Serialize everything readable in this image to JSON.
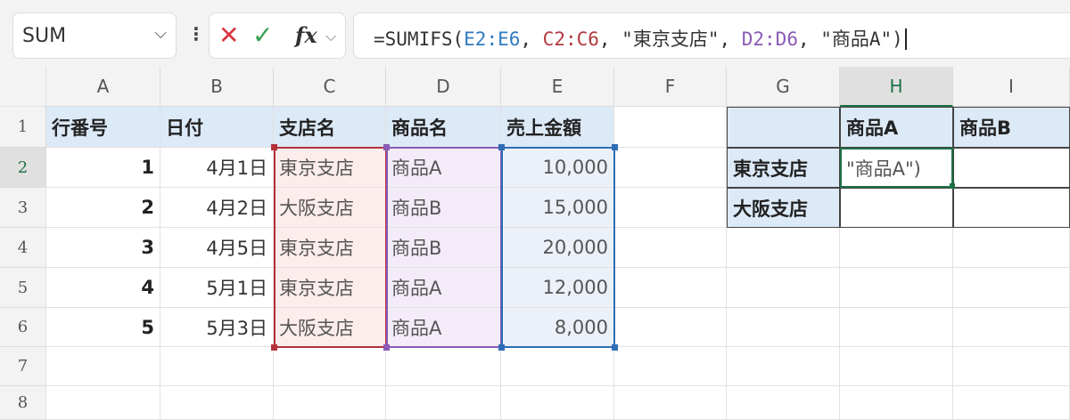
{
  "name_box": {
    "value": "SUM",
    "chevron_icon": "chevron-down"
  },
  "formula_bar": {
    "cancel_icon": "x-icon",
    "enter_icon": "check-icon",
    "fx_label": "fx",
    "formula_parts": [
      "=SUMIFS(",
      "E2:E6",
      ", ",
      "C2:C6",
      ", \"東京支店\", ",
      "D2:D6",
      ", \"商品A\")"
    ]
  },
  "colors": {
    "range_e": "#2f6db5",
    "range_c": "#b5323b",
    "range_d": "#8a5bb5",
    "active": "#1e7145"
  },
  "columns": [
    "A",
    "B",
    "C",
    "D",
    "E",
    "F",
    "G",
    "H",
    "I"
  ],
  "rows": [
    "1",
    "2",
    "3",
    "4",
    "5",
    "6",
    "7",
    "8"
  ],
  "cells": [
    [
      "行番号",
      "日付",
      "支店名",
      "商品名",
      "売上金額",
      "",
      "",
      "商品A",
      "商品B"
    ],
    [
      "1",
      "4月1日",
      "東京支店",
      "商品A",
      "10,000",
      "",
      "東京支店",
      "\"商品A\")",
      ""
    ],
    [
      "2",
      "4月2日",
      "大阪支店",
      "商品B",
      "15,000",
      "",
      "大阪支店",
      "",
      ""
    ],
    [
      "3",
      "4月5日",
      "東京支店",
      "商品B",
      "20,000",
      "",
      "",
      "",
      ""
    ],
    [
      "4",
      "5月1日",
      "東京支店",
      "商品A",
      "12,000",
      "",
      "",
      "",
      ""
    ],
    [
      "5",
      "5月3日",
      "大阪支店",
      "商品A",
      "8,000",
      "",
      "",
      "",
      ""
    ],
    [
      "",
      "",
      "",
      "",
      "",
      "",
      "",
      "",
      ""
    ],
    [
      "",
      "",
      "",
      "",
      "",
      "",
      "",
      "",
      ""
    ]
  ]
}
